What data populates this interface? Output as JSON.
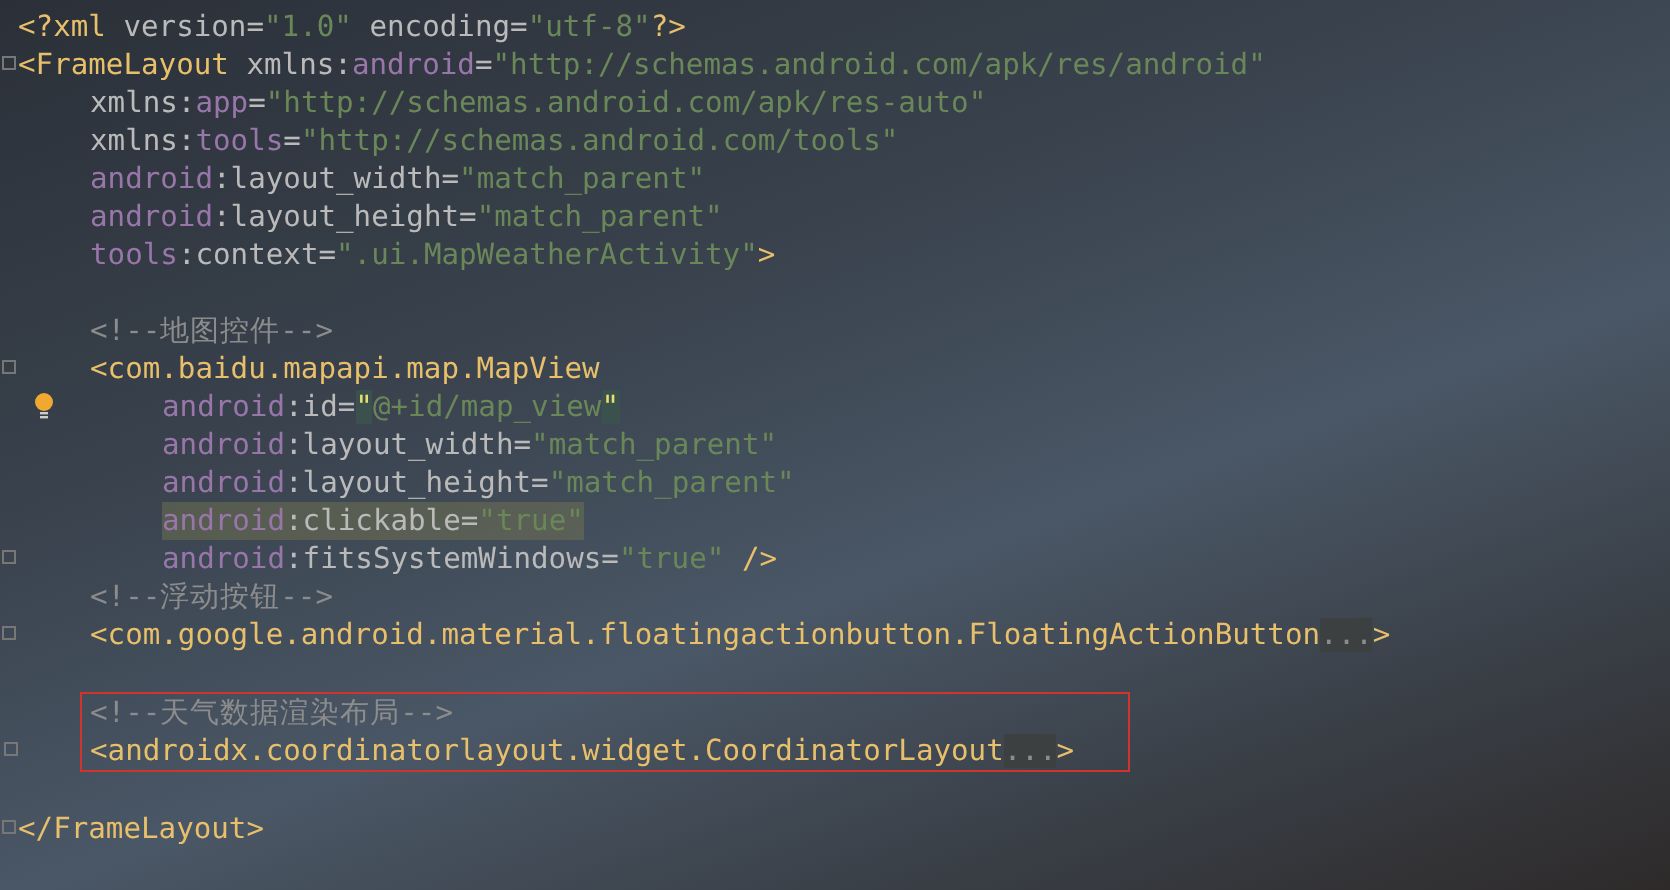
{
  "editor": {
    "lines": [
      {
        "kind": "root",
        "tokens": [
          {
            "kind": "tag",
            "text": "<?xml "
          },
          {
            "kind": "attr",
            "text": "version="
          },
          {
            "kind": "value",
            "text": "\"1.0\""
          },
          {
            "kind": "attr",
            "text": " encoding="
          },
          {
            "kind": "value",
            "text": "\"utf-8\""
          },
          {
            "kind": "tag",
            "text": "?>"
          }
        ]
      },
      {
        "kind": "root",
        "fold": true,
        "tokens": [
          {
            "kind": "tag",
            "text": "<FrameLayout "
          },
          {
            "kind": "attr",
            "text": "xmlns:"
          },
          {
            "kind": "ns",
            "text": "android"
          },
          {
            "kind": "attr",
            "text": "="
          },
          {
            "kind": "value",
            "text": "\"http://schemas.android.com/apk/res/android\""
          }
        ]
      },
      {
        "kind": "attr",
        "tokens": [
          {
            "kind": "attr",
            "text": "xmlns:"
          },
          {
            "kind": "ns",
            "text": "app"
          },
          {
            "kind": "attr",
            "text": "="
          },
          {
            "kind": "value",
            "text": "\"http://schemas.android.com/apk/res-auto\""
          }
        ]
      },
      {
        "kind": "attr",
        "tokens": [
          {
            "kind": "attr",
            "text": "xmlns:"
          },
          {
            "kind": "ns",
            "text": "tools"
          },
          {
            "kind": "attr",
            "text": "="
          },
          {
            "kind": "value",
            "text": "\"http://schemas.android.com/tools\""
          }
        ]
      },
      {
        "kind": "attr",
        "tokens": [
          {
            "kind": "ns",
            "text": "android"
          },
          {
            "kind": "attr",
            "text": ":layout_width="
          },
          {
            "kind": "value",
            "text": "\"match_parent\""
          }
        ]
      },
      {
        "kind": "attr",
        "tokens": [
          {
            "kind": "ns",
            "text": "android"
          },
          {
            "kind": "attr",
            "text": ":layout_height="
          },
          {
            "kind": "value",
            "text": "\"match_parent\""
          }
        ]
      },
      {
        "kind": "attr",
        "tokens": [
          {
            "kind": "ns",
            "text": "tools"
          },
          {
            "kind": "attr",
            "text": ":context="
          },
          {
            "kind": "value",
            "text": "\".ui.MapWeatherActivity\""
          },
          {
            "kind": "tag",
            "text": ">"
          }
        ]
      },
      {
        "kind": "blank"
      },
      {
        "kind": "attr",
        "tokens": [
          {
            "kind": "comment",
            "text": "<!--地图控件-->"
          }
        ]
      },
      {
        "kind": "attr",
        "fold": true,
        "tokens": [
          {
            "kind": "tag",
            "text": "<com.baidu.mapapi.map.MapView"
          }
        ]
      },
      {
        "kind": "child_attr",
        "hint": true,
        "tokens": [
          {
            "kind": "ns",
            "text": "android"
          },
          {
            "kind": "attr",
            "text": ":id="
          },
          {
            "kind": "match",
            "text": "\""
          },
          {
            "kind": "value",
            "text": "@+id/map_view"
          },
          {
            "kind": "match",
            "text": "\""
          }
        ]
      },
      {
        "kind": "child_attr",
        "tokens": [
          {
            "kind": "ns",
            "text": "android"
          },
          {
            "kind": "attr",
            "text": ":layout_width="
          },
          {
            "kind": "value",
            "text": "\"match_parent\""
          }
        ]
      },
      {
        "kind": "child_attr",
        "tokens": [
          {
            "kind": "ns",
            "text": "android"
          },
          {
            "kind": "attr",
            "text": ":layout_height="
          },
          {
            "kind": "value",
            "text": "\"match_parent\""
          }
        ]
      },
      {
        "kind": "child_attr",
        "highlighted": true,
        "tokens": [
          {
            "kind": "ns",
            "text": "android"
          },
          {
            "kind": "attr",
            "text": ":clickable="
          },
          {
            "kind": "value",
            "text": "\"true\""
          }
        ]
      },
      {
        "kind": "child_attr",
        "fold": true,
        "tokens": [
          {
            "kind": "ns",
            "text": "android"
          },
          {
            "kind": "attr",
            "text": ":fitsSystemWindows="
          },
          {
            "kind": "value",
            "text": "\"true\""
          },
          {
            "kind": "tag",
            "text": " />"
          }
        ]
      },
      {
        "kind": "attr",
        "tokens": [
          {
            "kind": "comment",
            "text": "<!--浮动按钮-->"
          }
        ]
      },
      {
        "kind": "attr",
        "fold": true,
        "tokens": [
          {
            "kind": "tag",
            "text": "<com.google.android.material.floatingactionbutton.FloatingActionButton"
          },
          {
            "kind": "fold",
            "text": "..."
          },
          {
            "kind": "tag",
            "text": ">"
          }
        ]
      },
      {
        "kind": "blank"
      },
      {
        "kind": "attr",
        "boxed": true,
        "tokens": [
          {
            "kind": "comment",
            "text": "<!--天气数据渲染布局-->"
          }
        ]
      },
      {
        "kind": "attr",
        "fold": true,
        "boxed": true,
        "tokens": [
          {
            "kind": "tag",
            "text": "<androidx.coordinatorlayout.widget.CoordinatorLayout"
          },
          {
            "kind": "fold",
            "text": "..."
          },
          {
            "kind": "tag",
            "text": ">"
          }
        ]
      },
      {
        "kind": "blank"
      },
      {
        "kind": "root",
        "fold": true,
        "tokens": [
          {
            "kind": "tag",
            "text": "</FrameLayout>"
          }
        ]
      }
    ]
  }
}
